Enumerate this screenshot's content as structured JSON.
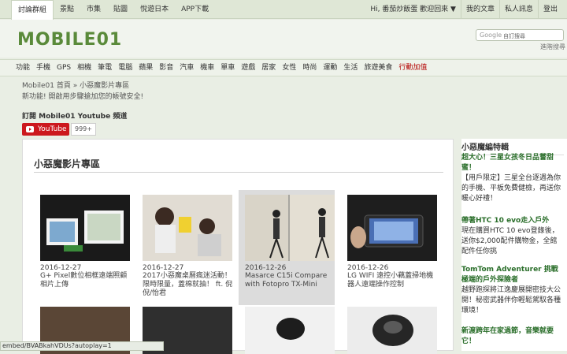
{
  "topbar": {
    "left": [
      "討論群組",
      "景點",
      "市集",
      "貼圖",
      "悅遊日本",
      "APP下載"
    ],
    "right": [
      "Hi, 番茄炒飯蛋 歡迎回來 ▼",
      "我的文章",
      "私人訊息",
      "登出"
    ]
  },
  "search": {
    "brand": "Google",
    "placeholder": "自訂搜尋",
    "advanced": "進階搜尋"
  },
  "nav": [
    "功能",
    "手機",
    "GPS",
    "相機",
    "筆電",
    "電腦",
    "蘋果",
    "影音",
    "汽車",
    "機車",
    "單車",
    "遊戲",
    "居家",
    "女性",
    "時尚",
    "運動",
    "生活",
    "旅遊美食",
    "行動加值"
  ],
  "breadcrumb": "Mobile01 首頁 » 小惡魔影片專區",
  "notice": "新功能! 開啟用步驟搶加您的帳號安全!",
  "subscribe": {
    "title": "訂閱 Mobile01 Youtube 頻道",
    "button": "YouTube",
    "count": "999+"
  },
  "main": {
    "title": "小惡魔影片專區",
    "videos": [
      {
        "date": "2016-12-27",
        "title": "G+ Pixel數位相框遠端照顧相片上傳"
      },
      {
        "date": "2016-12-27",
        "title": "2017小惡魔桌曆瘋迷活動！限時限量，蓋棉就抽！ ft. 倪倪/怡君"
      },
      {
        "date": "2016-12-26",
        "title": "Masarce C15i Compare with Fotopro TX-Mini"
      },
      {
        "date": "2016-12-26",
        "title": "LG WIFI 遠控小藕蓋掃地機器人遠端操作控制"
      }
    ]
  },
  "sidebar": {
    "title": "小惡魔編特輯",
    "items": [
      {
        "title": "超大心！三星女孩冬日品嘗甜蜜！",
        "desc": "【用戶限定】三星全台逐週為你的手機、平板免費健檢，再送你暖心好禮！"
      },
      {
        "title": "帶著HTC 10 evo走入戶外",
        "desc": "現在購買HTC 10 evo登錄後，送你$2,000配件購物金，全館配件任你挑"
      },
      {
        "title": "TomTom Adventurer 挑戰極端的戶外探險者",
        "desc": "越野跑探將江逸慶展開密技大公開！秘密武器伴你輕鬆駕馭各種環境！"
      },
      {
        "title": "新渡跨年在家過節，音樂就要它！",
        "desc": ""
      }
    ]
  },
  "status": "embed/BVABkahVDUs?autoplay=1"
}
